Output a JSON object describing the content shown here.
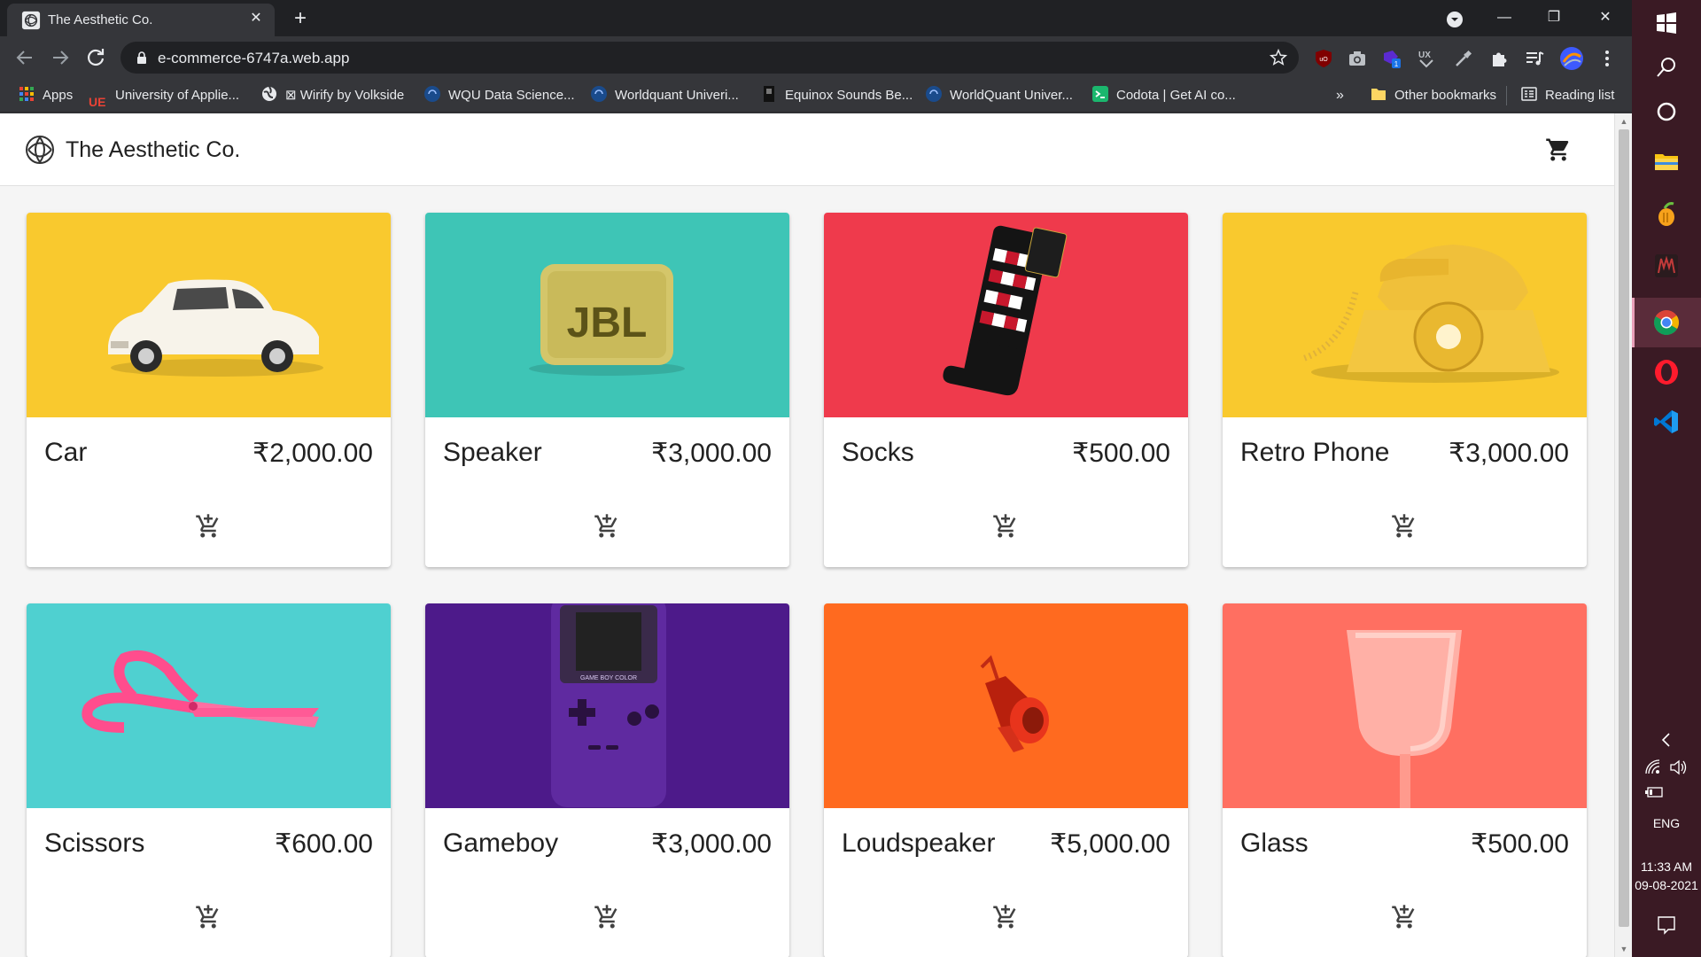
{
  "browser": {
    "tab_title": "The Aesthetic Co.",
    "url": "e-commerce-6747a.web.app",
    "bookmarks": [
      {
        "label": "Apps",
        "color": "#e94235"
      },
      {
        "label": "University of Applie...",
        "color": "#d93025"
      },
      {
        "label": "⊠ Wirify by Volkside",
        "color": "#e8eaed"
      },
      {
        "label": "WQU Data Science...",
        "color": "#1a4b8c"
      },
      {
        "label": "Worldquant Univeri...",
        "color": "#1a4b8c"
      },
      {
        "label": "Equinox Sounds Be...",
        "color": "#202124"
      },
      {
        "label": "WorldQuant Univer...",
        "color": "#1a4b8c"
      },
      {
        "label": "Codota | Get AI co...",
        "color": "#1bb76e"
      }
    ],
    "bookmarks_overflow": "»",
    "other_bookmarks": "Other bookmarks",
    "reading_list": "Reading list",
    "extension_badge": "1"
  },
  "page": {
    "brand": "The Aesthetic Co.",
    "products": [
      {
        "name": "Car",
        "price": "₹2,000.00",
        "image": "car",
        "bg": "#f9c92e"
      },
      {
        "name": "Speaker",
        "price": "₹3,000.00",
        "image": "speaker",
        "bg": "#3ec5b6"
      },
      {
        "name": "Socks",
        "price": "₹500.00",
        "image": "socks",
        "bg": "#ef3a4c"
      },
      {
        "name": "Retro Phone",
        "price": "₹3,000.00",
        "image": "phone",
        "bg": "#f9c92e"
      },
      {
        "name": "Scissors",
        "price": "₹600.00",
        "image": "scissors",
        "bg": "#4fd0d0"
      },
      {
        "name": "Gameboy",
        "price": "₹3,000.00",
        "image": "gameboy",
        "bg": "#4d1a8a"
      },
      {
        "name": "Loudspeaker",
        "price": "₹5,000.00",
        "image": "loudspeaker",
        "bg": "#ff6a1f"
      },
      {
        "name": "Glass",
        "price": "₹500.00",
        "image": "glass",
        "bg": "#ff6f61"
      }
    ],
    "gameboy_label": "GAME BOY COLOR"
  },
  "taskbar": {
    "language": "ENG",
    "time": "11:33 AM",
    "date": "09-08-2021",
    "icons": [
      "windows-icon",
      "search-icon",
      "cortana-icon",
      "file-explorer-icon",
      "fl-studio-icon",
      "predator-icon",
      "chrome-icon",
      "opera-icon",
      "vscode-icon"
    ]
  }
}
